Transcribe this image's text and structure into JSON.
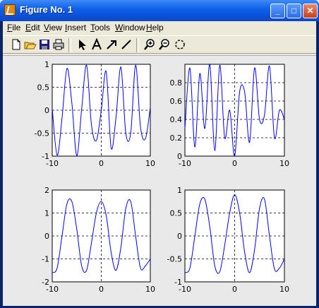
{
  "window": {
    "title": "Figure No. 1",
    "buttons": {
      "minimize": "_",
      "maximize": "□",
      "close": "✕"
    }
  },
  "menu": [
    "File",
    "Edit",
    "View",
    "Insert",
    "Tools",
    "Window",
    "Help"
  ],
  "toolbar": [
    "new-figure-icon",
    "open-file-icon",
    "save-icon",
    "print-icon",
    "select-arrow-icon",
    "text-tool-icon",
    "arrow-tool-icon",
    "line-tool-icon",
    "zoom-in-icon",
    "zoom-out-icon",
    "rotate-3d-icon"
  ],
  "chart_data": [
    {
      "type": "line",
      "panel": "top-left",
      "x": [
        -10,
        -9,
        -8,
        -7,
        -6,
        -5,
        -4,
        -3,
        -2,
        -1,
        0,
        1,
        2,
        3,
        4,
        5,
        6,
        7,
        8,
        9,
        10
      ],
      "y": [
        0.04,
        -0.98,
        -0.17,
        0.91,
        0.16,
        -0.99,
        0.02,
        0.98,
        -0.32,
        -0.66,
        0.0,
        0.84,
        -0.82,
        -0.16,
        0.94,
        -0.5,
        -0.5,
        0.98,
        -0.37,
        -0.62,
        0.06
      ],
      "xlim": [
        -10,
        10
      ],
      "ylim": [
        -1,
        1
      ],
      "xticks": [
        "-10",
        "0",
        "10"
      ],
      "yticks": [
        "-1",
        "-0.5",
        "0",
        "0.5",
        "1"
      ],
      "color": "#0000ff"
    },
    {
      "type": "line",
      "panel": "top-right",
      "x": [
        -10,
        -9,
        -8,
        -7,
        -6,
        -5,
        -4,
        -3,
        -2,
        -1,
        0,
        1,
        2,
        3,
        4,
        5,
        6,
        7,
        8,
        9,
        10
      ],
      "y": [
        0.3,
        0.96,
        0.1,
        0.9,
        0.3,
        1.0,
        0.06,
        0.99,
        0.2,
        0.5,
        0.0,
        0.7,
        0.7,
        0.15,
        0.96,
        0.4,
        0.45,
        0.98,
        0.2,
        0.5,
        0.4
      ],
      "xlim": [
        -10,
        10
      ],
      "ylim": [
        0,
        1
      ],
      "xticks": [
        "-10",
        "0",
        "10"
      ],
      "yticks": [
        "0",
        "0.2",
        "0.4",
        "0.6",
        "0.8"
      ],
      "color": "#0000ff"
    },
    {
      "type": "line",
      "panel": "bottom-left",
      "x": [
        -10,
        -9,
        -8,
        -7,
        -6,
        -5,
        -4,
        -3,
        -2,
        -1,
        0,
        1,
        2,
        3,
        4,
        5,
        6,
        7,
        8,
        9,
        10
      ],
      "y": [
        -1.6,
        -1.4,
        0.0,
        1.4,
        1.5,
        0.3,
        -1.3,
        -1.5,
        -0.3,
        1.0,
        1.5,
        0.9,
        -0.7,
        -1.5,
        -0.5,
        1.2,
        1.5,
        0.0,
        -1.4,
        -1.3,
        -1.0
      ],
      "xlim": [
        -10,
        10
      ],
      "ylim": [
        -2,
        2
      ],
      "xticks": [
        "-10",
        "0",
        "10"
      ],
      "yticks": [
        "-2",
        "-1",
        "0",
        "1",
        "2"
      ],
      "color": "#0000ff"
    },
    {
      "type": "line",
      "panel": "bottom-right",
      "x": [
        -10,
        -9,
        -8,
        -7,
        -6,
        -5,
        -4,
        -3,
        -2,
        -1,
        0,
        1,
        2,
        3,
        4,
        5,
        6,
        7,
        8,
        9,
        10
      ],
      "y": [
        -0.8,
        -0.7,
        0.0,
        0.7,
        0.8,
        0.2,
        -0.65,
        -0.78,
        -0.2,
        0.5,
        0.9,
        0.5,
        -0.35,
        -0.8,
        -0.3,
        0.6,
        0.8,
        0.0,
        -0.72,
        -0.7,
        -0.5
      ],
      "xlim": [
        -10,
        10
      ],
      "ylim": [
        -1,
        1
      ],
      "xticks": [
        "-10",
        "0",
        "10"
      ],
      "yticks": [
        "-1",
        "-0.5",
        "0",
        "0.5",
        "1"
      ],
      "color": "#0000ff"
    }
  ]
}
